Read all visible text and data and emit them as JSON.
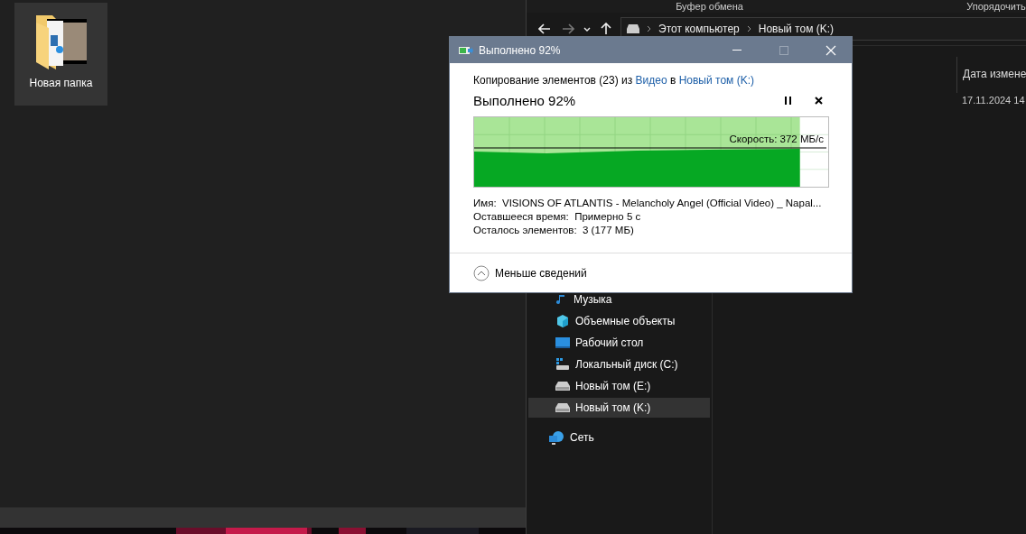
{
  "desktop": {
    "icons": [
      {
        "label": "Новая папка",
        "selected": true
      }
    ]
  },
  "explorer": {
    "ribbon_groups": [
      "Буфер обмена",
      "Упорядочить"
    ],
    "address": [
      "Этот компьютер",
      "Новый том (K:)"
    ],
    "columns": [
      "Дата измене"
    ],
    "rows": [
      {
        "date": "17.11.2024 14"
      }
    ],
    "nav_items": [
      {
        "label": "Музыка",
        "kind": "music",
        "selected": false
      },
      {
        "label": "Объемные объекты",
        "kind": "objects3d",
        "selected": false
      },
      {
        "label": "Рабочий стол",
        "kind": "desktop",
        "selected": false
      },
      {
        "label": "Локальный диск (C:)",
        "kind": "system-drive",
        "selected": false
      },
      {
        "label": "Новый том (E:)",
        "kind": "drive",
        "selected": false
      },
      {
        "label": "Новый том (K:)",
        "kind": "drive",
        "selected": true
      },
      {
        "label": "Сеть",
        "kind": "network",
        "selected": false
      }
    ]
  },
  "dialog": {
    "title": "Выполнено 92%",
    "summary": {
      "prefix": "Копирование элементов (23) из",
      "source": "Видео",
      "joiner": "в",
      "destination": "Новый том (K:)"
    },
    "heading": "Выполнено 92%",
    "paused": false,
    "progress": {
      "level": 0.92,
      "speed": "Скорость: 372 МБ/с"
    },
    "details": [
      {
        "label": "Имя:",
        "value": "VISIONS OF ATLANTIS - Melancholy Angel (Official Video) _ Napal..."
      },
      {
        "label": "Оставшееся время:",
        "value": "Примерно 5 с"
      },
      {
        "label": "Осталось элементов:",
        "value": "3 (177 МБ)"
      }
    ],
    "toggle": {
      "label": "Меньше сведений",
      "expanded": true
    }
  }
}
